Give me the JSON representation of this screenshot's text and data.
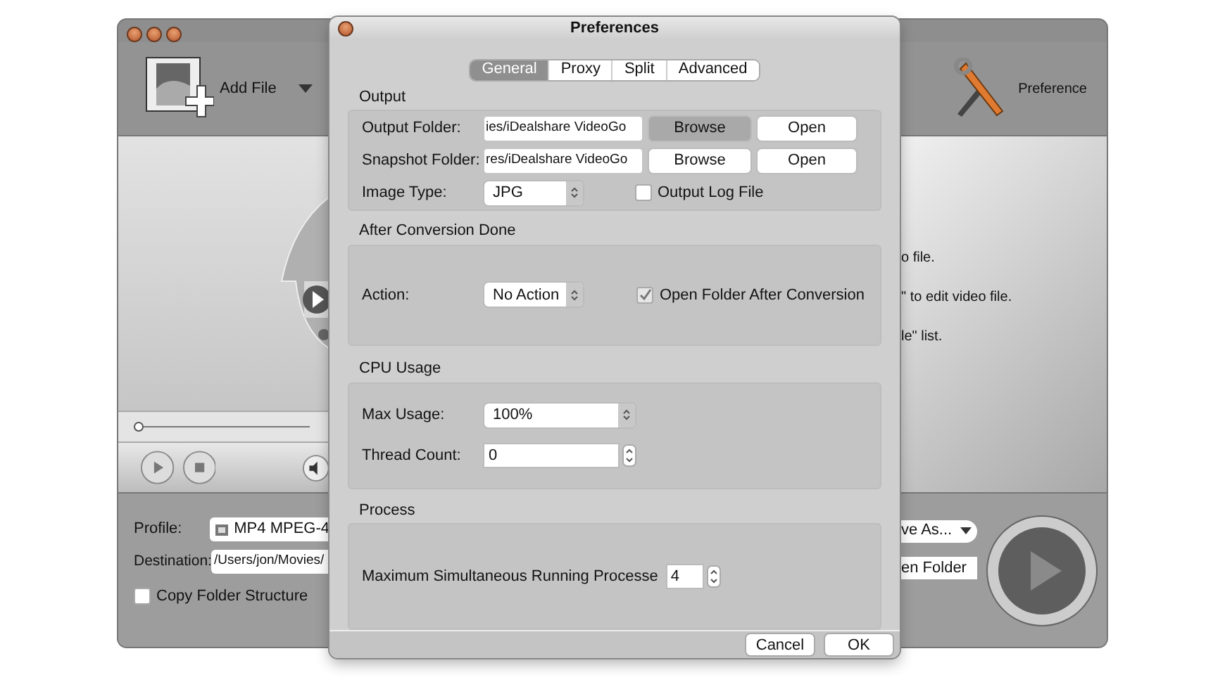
{
  "main_window": {
    "add_file": "Add File",
    "preference": "Preference",
    "seek": {
      "level": 0
    },
    "getting_started_visible": [
      "o file.",
      "\" to edit video file.",
      "le\" list."
    ],
    "profile": {
      "label": "Profile:",
      "value": "MP4 MPEG-4"
    },
    "destination": {
      "label": "Destination:",
      "value": "/Users/jon/Movies/"
    },
    "copy_folder_structure": {
      "label": "Copy Folder Structure",
      "checked": false
    },
    "save_as": "ve As...",
    "open_folder": "en Folder"
  },
  "preferences": {
    "title": "Preferences",
    "tabs": [
      {
        "label": "General",
        "selected": true
      },
      {
        "label": "Proxy",
        "selected": false
      },
      {
        "label": "Split",
        "selected": false
      },
      {
        "label": "Advanced",
        "selected": false
      }
    ],
    "output": {
      "title": "Output",
      "output_folder": {
        "label": "Output Folder:",
        "value": "ies/iDealshare VideoGo",
        "browse": "Browse",
        "open": "Open"
      },
      "snapshot_folder": {
        "label": "Snapshot Folder:",
        "value": "res/iDealshare VideoGo",
        "browse": "Browse",
        "open": "Open"
      },
      "image_type": {
        "label": "Image Type:",
        "value": "JPG"
      },
      "output_log_file": {
        "label": "Output Log File",
        "checked": false
      }
    },
    "after_conversion": {
      "title": "After Conversion Done",
      "action": {
        "label": "Action:",
        "value": "No Action"
      },
      "open_folder_after": {
        "label": "Open Folder After Conversion",
        "checked": true
      }
    },
    "cpu_usage": {
      "title": "CPU Usage",
      "max_usage": {
        "label": "Max Usage:",
        "value": "100%"
      },
      "thread_count": {
        "label": "Thread Count:",
        "value": "0"
      }
    },
    "process": {
      "title": "Process",
      "max_processes": {
        "label": "Maximum Simultaneous Running Processe",
        "value": "4"
      }
    },
    "buttons": {
      "cancel": "Cancel",
      "ok": "OK"
    }
  }
}
